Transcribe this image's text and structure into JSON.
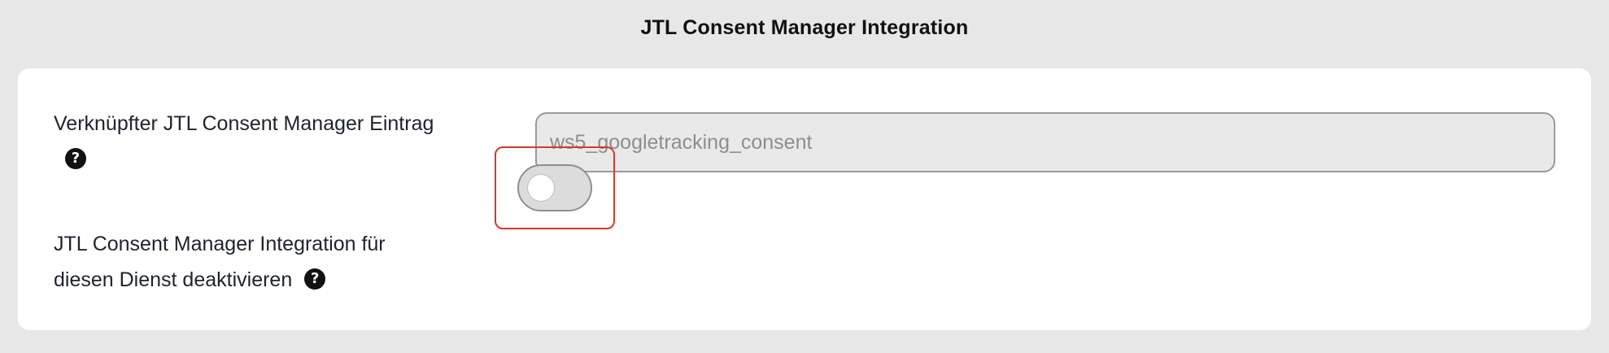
{
  "section": {
    "title": "JTL Consent Manager Integration"
  },
  "fields": {
    "linked_entry": {
      "label": "Verknüpfter JTL Consent Manager Eintrag",
      "value": "ws5_googletracking_consent",
      "help_icon": "question-circle-icon"
    },
    "disable_integration": {
      "label_line1": "JTL Consent Manager Integration für",
      "label_line2": "diesen Dienst deaktivieren",
      "help_icon": "question-circle-icon",
      "checked": false
    }
  },
  "colors": {
    "page_bg": "#e7e7e7",
    "card_bg": "#ffffff",
    "highlight_border": "#d23b2f",
    "input_bg": "#e9e9e9",
    "input_text": "#8e8e8e"
  }
}
